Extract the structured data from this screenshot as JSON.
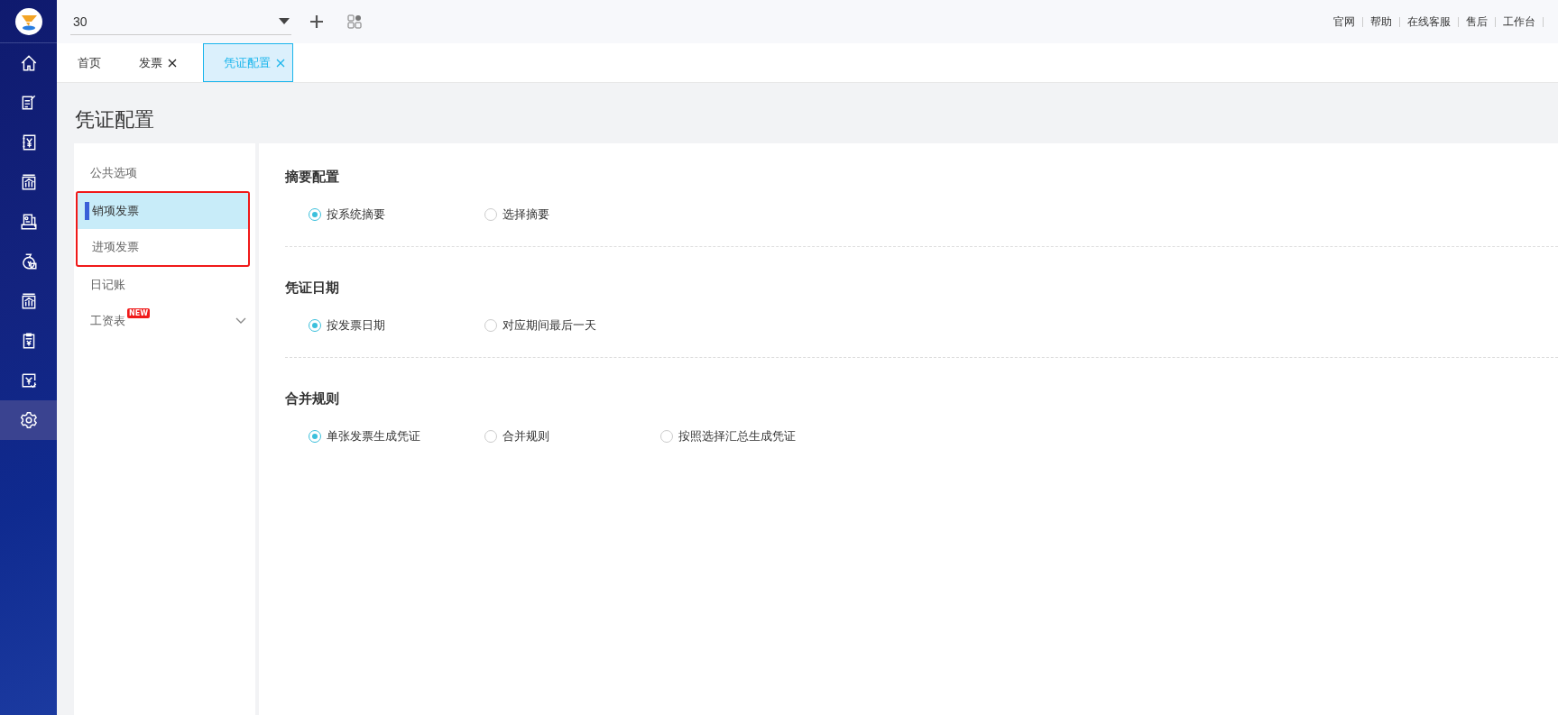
{
  "nav": [
    {
      "kind": "home",
      "selected": false
    },
    {
      "kind": "note",
      "selected": false
    },
    {
      "kind": "yen-book",
      "selected": false
    },
    {
      "kind": "chart",
      "selected": false
    },
    {
      "kind": "person-card",
      "selected": false
    },
    {
      "kind": "money-bag",
      "selected": false
    },
    {
      "kind": "chart",
      "selected": false
    },
    {
      "kind": "clipboard",
      "selected": false
    },
    {
      "kind": "yen-check",
      "selected": false
    },
    {
      "kind": "gear",
      "selected": true
    }
  ],
  "toolbar": {
    "select_value": "30"
  },
  "header_links": [
    "官网",
    "帮助",
    "在线客服",
    "售后",
    "工作台"
  ],
  "tabs": [
    {
      "label": "首页",
      "closable": false,
      "selected": false
    },
    {
      "label": "发票",
      "closable": true,
      "selected": false
    },
    {
      "label": "凭证配置",
      "closable": true,
      "selected": true
    }
  ],
  "page_title": "凭证配置",
  "menu": [
    {
      "label": "公共选项",
      "selected": false,
      "highlighted": false
    },
    {
      "label": "销项发票",
      "selected": true,
      "highlighted": true
    },
    {
      "label": "进项发票",
      "selected": false,
      "highlighted": true
    },
    {
      "label": "日记账",
      "selected": false,
      "highlighted": false
    },
    {
      "label": "工资表",
      "selected": false,
      "highlighted": false,
      "badge": "NEW",
      "expanded": false
    }
  ],
  "sections": [
    {
      "title": "摘要配置",
      "options": [
        {
          "label": "按系统摘要",
          "selected": true
        },
        {
          "label": "选择摘要",
          "selected": false
        }
      ]
    },
    {
      "title": "凭证日期",
      "options": [
        {
          "label": "按发票日期",
          "selected": true
        },
        {
          "label": "对应期间最后一天",
          "selected": false
        }
      ]
    },
    {
      "title": "合并规则",
      "options": [
        {
          "label": "单张发票生成凭证",
          "selected": true
        },
        {
          "label": "合并规则",
          "selected": false
        },
        {
          "label": "按照选择汇总生成凭证",
          "selected": false
        }
      ]
    }
  ]
}
